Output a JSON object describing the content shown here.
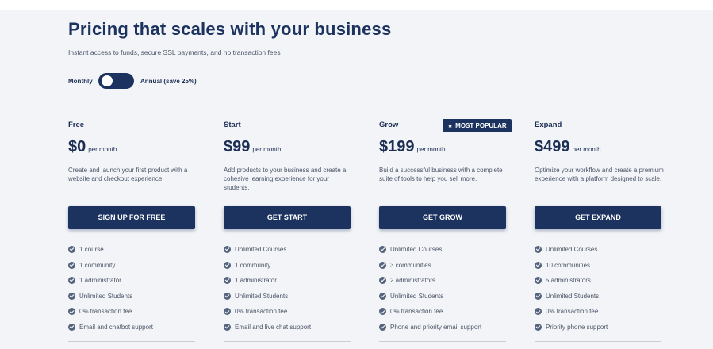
{
  "header": {
    "title": "Pricing that scales with your business",
    "subtitle": "Instant access to funds, secure SSL payments, and no transaction fees"
  },
  "billing": {
    "monthly_label": "Monthly",
    "annual_label": "Annual (save 25%)",
    "toggle_state": "monthly"
  },
  "plans": [
    {
      "name": "Free",
      "price": "$0",
      "period": "per month",
      "description": "Create and launch your first product with a website and checkout experience.",
      "cta": "SIGN UP FOR FREE",
      "features": [
        "1 course",
        "1 community",
        "1 administrator",
        "Unlimited Students",
        "0% transaction fee",
        "Email and chatbot support"
      ]
    },
    {
      "name": "Start",
      "price": "$99",
      "period": "per month",
      "description": "Add products to your business and create a cohesive learning experience for your students.",
      "cta": "GET START",
      "features": [
        "Unlimited Courses",
        "1 community",
        "1 administrator",
        "Unlimited Students",
        "0% transaction fee",
        "Email and live chat support"
      ]
    },
    {
      "name": "Grow",
      "badge": "MOST POPULAR",
      "badge_icon": "star-icon",
      "price": "$199",
      "period": "per month",
      "description": "Build a successful business with a complete suite of tools to help you sell more.",
      "cta": "GET GROW",
      "features": [
        "Unlimited Courses",
        "3 communities",
        "2 administrators",
        "Unlimited Students",
        "0% transaction fee",
        "Phone and priority email support"
      ]
    },
    {
      "name": "Expand",
      "price": "$499",
      "period": "per month",
      "description": "Optimize your workflow and create a premium experience with a platform designed to scale.",
      "cta": "GET EXPAND",
      "features": [
        "Unlimited Courses",
        "10 communities",
        "5 administrators",
        "Unlimited Students",
        "0% transaction fee",
        "Priority phone support"
      ]
    }
  ],
  "colors": {
    "primary": "#1c3360",
    "background": "#f2f4f7",
    "text_muted": "#4a5568"
  }
}
